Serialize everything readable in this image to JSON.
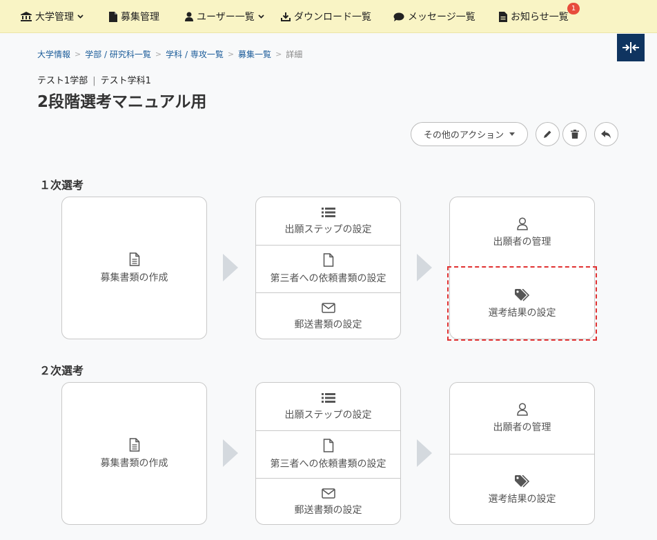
{
  "navbar": {
    "items": [
      {
        "label": "大学管理",
        "icon": "university-icon",
        "dropdown": true
      },
      {
        "label": "募集管理",
        "icon": "file-icon",
        "dropdown": false
      },
      {
        "label": "ユーザー一覧",
        "icon": "user-icon",
        "dropdown": true
      },
      {
        "label": "ダウンロード一覧",
        "icon": "download-icon",
        "dropdown": false
      },
      {
        "label": "メッセージ一覧",
        "icon": "comment-icon",
        "dropdown": false
      },
      {
        "label": "お知らせ一覧",
        "icon": "file-text-icon",
        "dropdown": false,
        "badge": "1"
      }
    ],
    "background": "#f9f4c5"
  },
  "collapse_button": {
    "icon": "collapse-horizontal-icon",
    "background": "#0f3460"
  },
  "breadcrumb": [
    "大学情報",
    "学部 / 研究科一覧",
    "学科 / 専攻一覧",
    "募集一覧",
    "詳細"
  ],
  "header": {
    "faculty": "テスト1学部",
    "department": "テスト学科1",
    "title": "2段階選考マニュアル用"
  },
  "toolbar": {
    "other_actions": "その他のアクション",
    "edit_icon": "pencil-icon",
    "delete_icon": "trash-icon",
    "back_icon": "reply-icon"
  },
  "stages": [
    {
      "title": "１次選考",
      "create_docs": "募集書類の作成",
      "settings": [
        "出願ステップの設定",
        "第三者への依頼書類の設定",
        "郵送書類の設定"
      ],
      "manage": [
        "出願者の管理",
        "選考結果の設定"
      ]
    },
    {
      "title": "２次選考",
      "create_docs": "募集書類の作成",
      "settings": [
        "出願ステップの設定",
        "第三者への依頼書類の設定",
        "郵送書類の設定"
      ],
      "manage": [
        "出願者の管理",
        "選考結果の設定"
      ]
    }
  ],
  "colors": {
    "link": "#1b5c99",
    "highlight": "#e03030",
    "badge": "#e74c3c"
  }
}
